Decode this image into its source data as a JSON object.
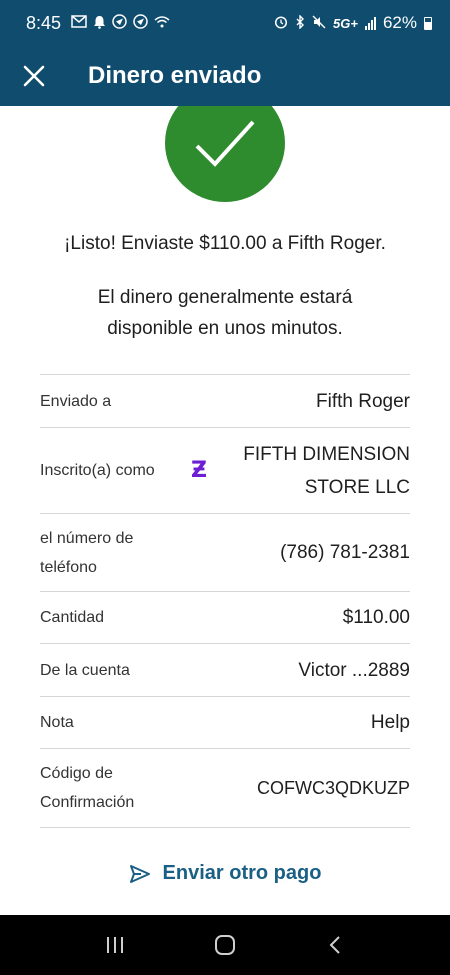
{
  "status_bar": {
    "time": "8:45",
    "network": "5G+",
    "battery": "62%"
  },
  "app_bar": {
    "title": "Dinero enviado"
  },
  "confirmation": {
    "headline": "¡Listo! Enviaste $110.00 a Fifth Roger.",
    "subtext": "El dinero generalmente estará disponible en unos minutos."
  },
  "details": [
    {
      "label": "Enviado a",
      "value": "Fifth Roger"
    },
    {
      "label": "Inscrito(a) como",
      "value_line1": "FIFTH DIMENSION",
      "value_line2": "STORE LLC"
    },
    {
      "label_line1": "el número de",
      "label_line2": "teléfono",
      "value": "(786) 781-2381"
    },
    {
      "label": "Cantidad",
      "value": "$110.00"
    },
    {
      "label": "De la cuenta",
      "value": "Victor ...2889"
    },
    {
      "label": "Nota",
      "value": "Help"
    },
    {
      "label_line1": "Código de",
      "label_line2": "Confirmación",
      "value": "COFWC3QDKUZP"
    }
  ],
  "zelle_logo": "Ƶ",
  "actions": {
    "send_another": "Enviar otro pago"
  },
  "colors": {
    "header": "#0f4c6e",
    "success": "#2e8b2e",
    "zelle": "#6d1ed4",
    "link": "#1a5f84"
  }
}
